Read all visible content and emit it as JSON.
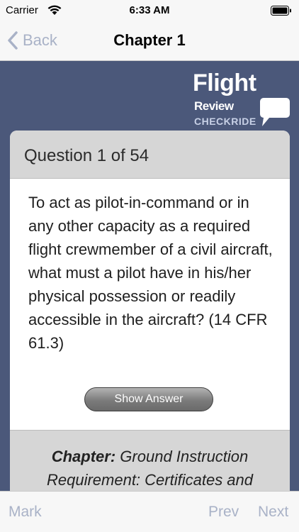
{
  "status_bar": {
    "carrier": "Carrier",
    "time": "6:33 AM"
  },
  "nav": {
    "back_label": "Back",
    "title": "Chapter 1"
  },
  "logo": {
    "line1": "Flight",
    "line2": "Review",
    "line3": "CHECKRIDE"
  },
  "question": {
    "header": "Question 1 of 54",
    "text": "To act as pilot-in-command or in any other capacity as a required flight crewmember of a civil aircraft, what must a pilot have in his/her physical possession or readily accessible in the aircraft? (14 CFR 61.3)",
    "show_answer_label": "Show Answer"
  },
  "chapter": {
    "label": "Chapter:",
    "value": "Ground Instruction Requirement: Certificates and"
  },
  "toolbar": {
    "mark_label": "Mark",
    "prev_label": "Prev",
    "next_label": "Next"
  },
  "colors": {
    "main_background": "#4b587a",
    "toolbar_text": "#a9b2c7",
    "card_header": "#d6d6d6"
  }
}
